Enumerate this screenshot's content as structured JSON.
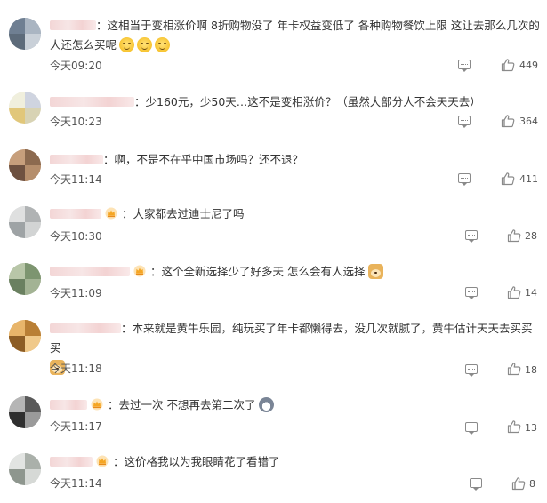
{
  "comments": [
    {
      "text": "这相当于变相涨价啊 8折购物没了 年卡权益变低了 各种购物餐饮上限 这让去那么几次的人还怎么买呢",
      "time": "今天09:20",
      "likes": "449",
      "emojis": [
        "smile-emoji",
        "smile-emoji",
        "smile-emoji"
      ]
    },
    {
      "text": "少160元，少50天…这不是变相涨价？（虽然大部分人不会天天去）",
      "time": "今天10:23",
      "likes": "364"
    },
    {
      "text": "啊，不是不在乎中国市场吗？还不退？",
      "time": "今天11:14",
      "likes": "411"
    },
    {
      "text": "大家都去过迪士尼了吗",
      "time": "今天10:30",
      "likes": "28"
    },
    {
      "text": "这个全新选择少了好多天 怎么会有人选择",
      "time": "今天11:09",
      "likes": "14",
      "emojis": [
        "doge-emoji"
      ]
    },
    {
      "text": "本来就是黄牛乐园，纯玩买了年卡都懒得去，没几次就腻了，黄牛估计天天去买买买",
      "time": "今天11:18",
      "likes": "18",
      "emojis": [
        "doge-emoji"
      ]
    },
    {
      "text": "去过一次 不想再去第二次了",
      "time": "今天11:17",
      "likes": "13",
      "emojis": [
        "husky-emoji"
      ]
    },
    {
      "text": "这价格我以为我眼睛花了看错了",
      "time": "今天11:14",
      "likes": "8"
    }
  ],
  "icons": {
    "reply": "comment-bubble-icon",
    "like": "thumbs-up-icon",
    "badge": "crown-badge-icon"
  },
  "colors": {
    "text": "#333333",
    "meta": "#555555",
    "icon": "#8a8a8a",
    "badge": "#f5a623"
  }
}
